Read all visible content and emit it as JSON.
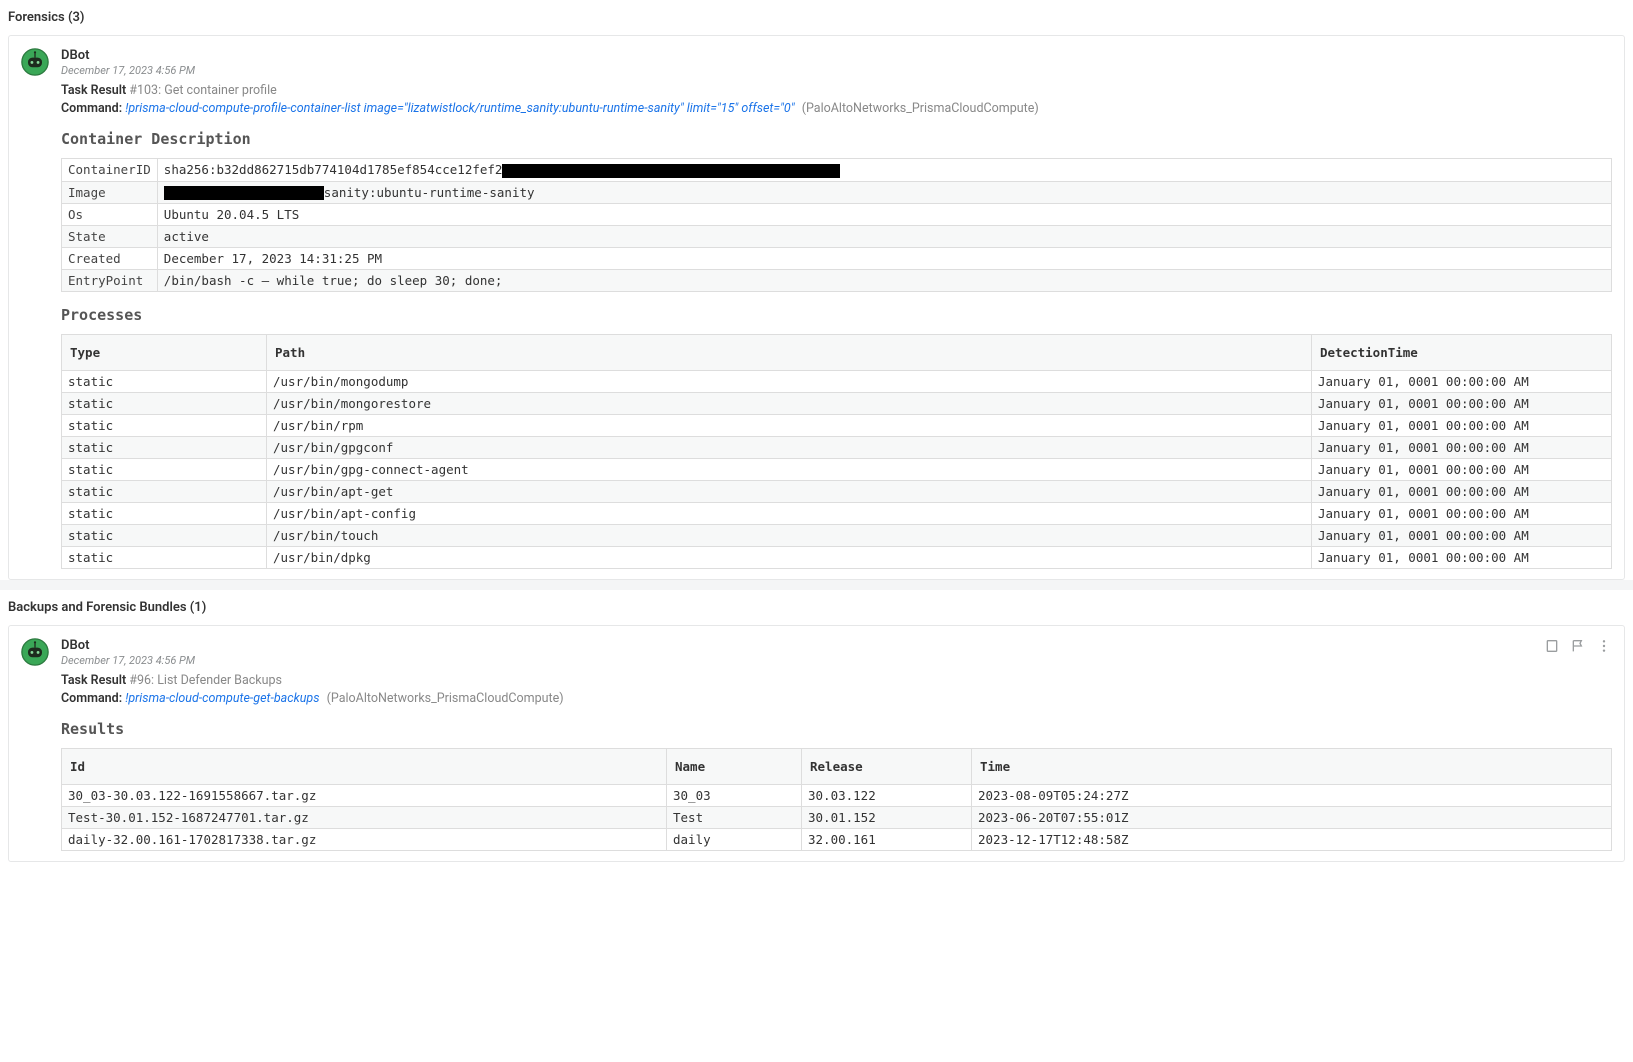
{
  "section1": {
    "title": "Forensics (3)"
  },
  "entry1": {
    "author": "DBot",
    "timestamp": "December 17, 2023 4:56 PM",
    "task_label": "Task Result",
    "task_id": "#103:",
    "task_name": "Get container profile",
    "command_label": "Command:",
    "command_text": "!prisma-cloud-compute-profile-container-list image=\"lizatwistlock/runtime_sanity:ubuntu-runtime-sanity\" limit=\"15\" offset=\"0\"",
    "integration": "(PaloAltoNetworks_PrismaCloudCompute)",
    "heading1": "Container Description",
    "container": {
      "rows": [
        {
          "k": "ContainerID",
          "v_pre": "sha256:b32dd862715db774104d1785ef854cce12fef2",
          "redact_after": 338,
          "v_post": ""
        },
        {
          "k": "Image",
          "v_pre": "",
          "redact_before": 160,
          "v_post": "sanity:ubuntu-runtime-sanity"
        },
        {
          "k": "Os",
          "v_pre": "Ubuntu 20.04.5 LTS"
        },
        {
          "k": "State",
          "v_pre": "active"
        },
        {
          "k": "Created",
          "v_pre": "December 17, 2023 14:31:25 PM"
        },
        {
          "k": "EntryPoint",
          "v_pre": "/bin/bash -c — while true; do sleep 30; done;"
        }
      ]
    },
    "heading2": "Processes",
    "processes": {
      "headers": [
        "Type",
        "Path",
        "DetectionTime"
      ],
      "rows": [
        [
          "static",
          "/usr/bin/mongodump",
          "January 01, 0001 00:00:00 AM"
        ],
        [
          "static",
          "/usr/bin/mongorestore",
          "January 01, 0001 00:00:00 AM"
        ],
        [
          "static",
          "/usr/bin/rpm",
          "January 01, 0001 00:00:00 AM"
        ],
        [
          "static",
          "/usr/bin/gpgconf",
          "January 01, 0001 00:00:00 AM"
        ],
        [
          "static",
          "/usr/bin/gpg-connect-agent",
          "January 01, 0001 00:00:00 AM"
        ],
        [
          "static",
          "/usr/bin/apt-get",
          "January 01, 0001 00:00:00 AM"
        ],
        [
          "static",
          "/usr/bin/apt-config",
          "January 01, 0001 00:00:00 AM"
        ],
        [
          "static",
          "/usr/bin/touch",
          "January 01, 0001 00:00:00 AM"
        ],
        [
          "static",
          "/usr/bin/dpkg",
          "January 01, 0001 00:00:00 AM"
        ]
      ]
    }
  },
  "section2": {
    "title": "Backups and Forensic Bundles (1)"
  },
  "entry2": {
    "author": "DBot",
    "timestamp": "December 17, 2023 4:56 PM",
    "task_label": "Task Result",
    "task_id": "#96:",
    "task_name": "List Defender Backups",
    "command_label": "Command:",
    "command_text": "!prisma-cloud-compute-get-backups",
    "integration": "(PaloAltoNetworks_PrismaCloudCompute)",
    "heading1": "Results",
    "results": {
      "headers": [
        "Id",
        "Name",
        "Release",
        "Time"
      ],
      "rows": [
        [
          "30_03-30.03.122-1691558667.tar.gz",
          "30_03",
          "30.03.122",
          "2023-08-09T05:24:27Z"
        ],
        [
          "Test-30.01.152-1687247701.tar.gz",
          "Test",
          "30.01.152",
          "2023-06-20T07:55:01Z"
        ],
        [
          "daily-32.00.161-1702817338.tar.gz",
          "daily",
          "32.00.161",
          "2023-12-17T12:48:58Z"
        ]
      ]
    }
  }
}
